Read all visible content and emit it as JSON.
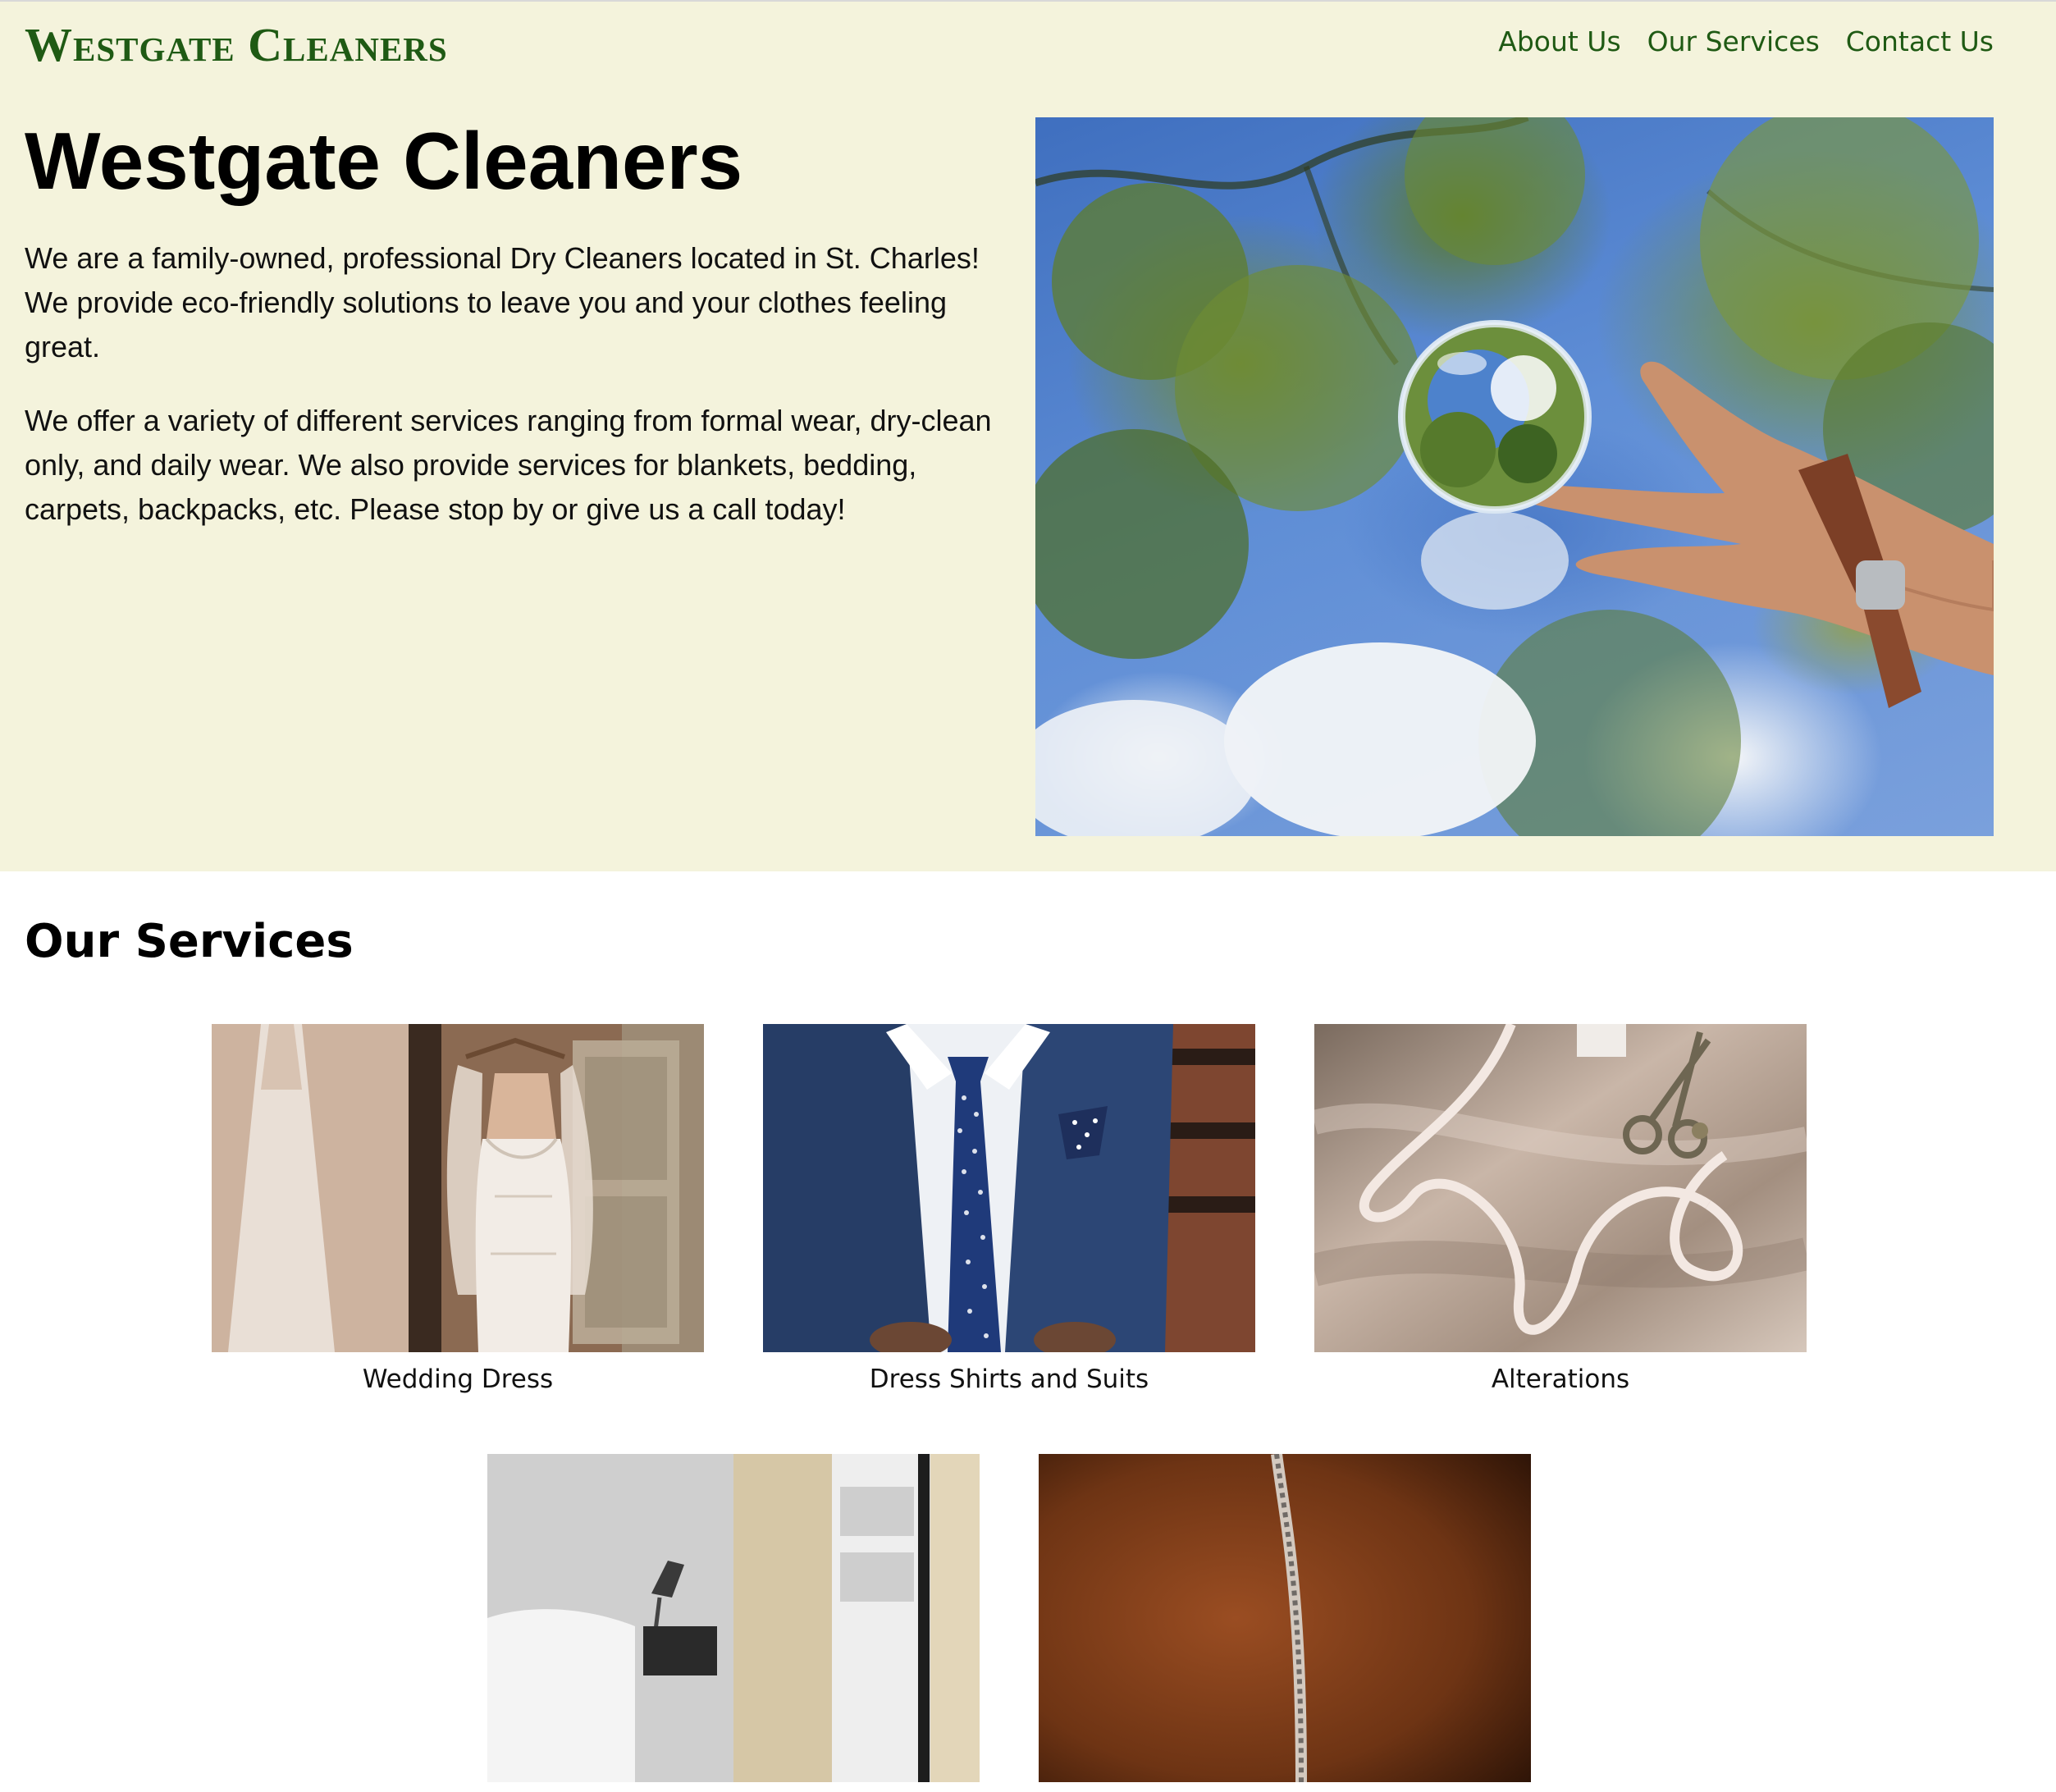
{
  "header": {
    "brand": "Westgate Cleaners",
    "nav": [
      {
        "label": "About Us"
      },
      {
        "label": "Our Services"
      },
      {
        "label": "Contact Us"
      }
    ]
  },
  "hero": {
    "title": "Westgate Cleaners",
    "paragraphs": [
      "We are a family-owned, professional Dry Cleaners located in St. Charles! We provide eco-friendly solutions to leave you and your clothes feeling great.",
      "We offer a variety of different services ranging from formal wear, dry-clean only, and daily wear. We also provide services for blankets, bedding, carpets, backpacks, etc. Please stop by or give us a call today!"
    ]
  },
  "services": {
    "title": "Our Services",
    "items": [
      {
        "label": "Wedding Dress"
      },
      {
        "label": "Dress Shirts and Suits"
      },
      {
        "label": "Alterations"
      },
      {
        "label": ""
      },
      {
        "label": ""
      }
    ]
  },
  "colors": {
    "hero_background": "#f4f3dc",
    "brand_green": "#1f5a14",
    "page_background": "#ffffff"
  }
}
